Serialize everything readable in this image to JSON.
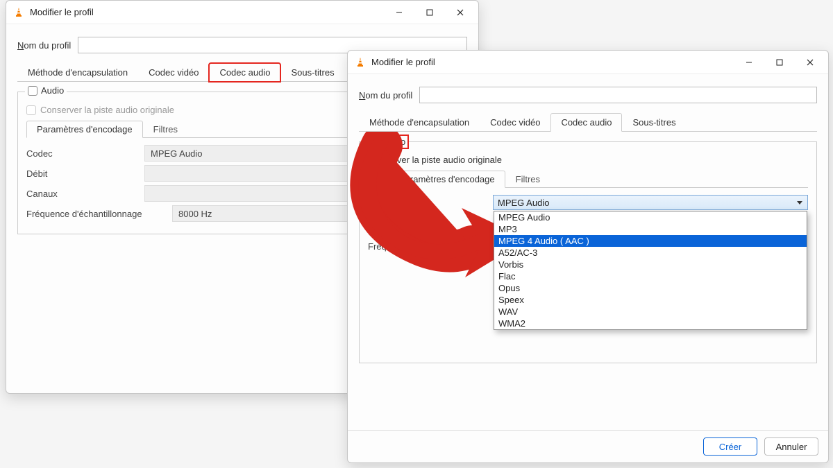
{
  "title": "Modifier le profil",
  "profile": {
    "label_pre": "N",
    "label_rest": "om du profil"
  },
  "tabs": [
    "Méthode d'encapsulation",
    "Codec vidéo",
    "Codec audio",
    "Sous-titres"
  ],
  "tabs_active_index": 2,
  "audio": {
    "legend": "Audio",
    "keep_original": "Conserver la piste audio originale",
    "subtabs": [
      "Paramètres d'encodage",
      "Filtres"
    ],
    "subtabs_active_index": 0,
    "params": {
      "codec_label": "Codec",
      "codec_value": "MPEG Audio",
      "debit_label": "Débit",
      "canaux_label": "Canaux",
      "freq_label": "Fréquence d'échantillonnage",
      "freq_value": "8000 Hz",
      "debit_short": "Débi",
      "freq_short": "Fréquence d'échal"
    },
    "codec_options": [
      "MPEG Audio",
      "MP3",
      "MPEG 4 Audio ( AAC )",
      "A52/AC-3",
      "Vorbis",
      "Flac",
      "Opus",
      "Speex",
      "WAV",
      "WMA2"
    ],
    "codec_selected_index": 2
  },
  "buttons": {
    "create": "Créer",
    "cancel": "Annuler"
  },
  "win2_params": {
    "freq_suffix": "onnage"
  }
}
